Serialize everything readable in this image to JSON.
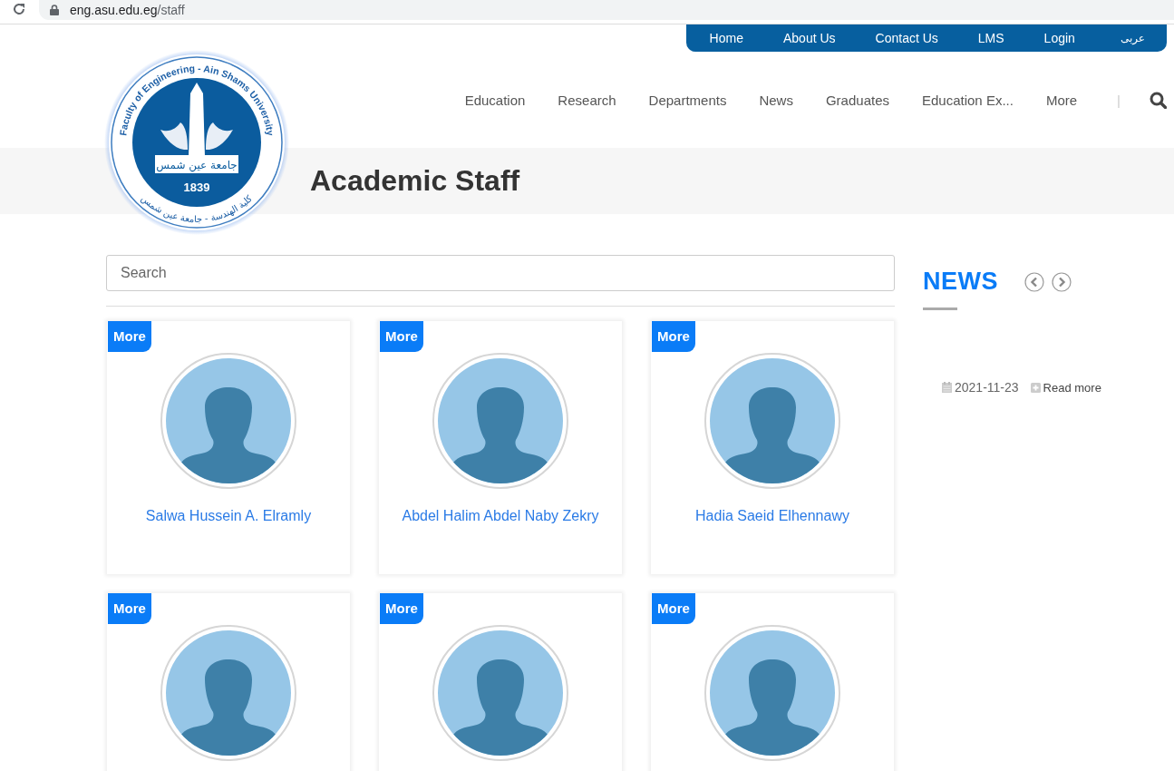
{
  "browser": {
    "url_host": "eng.asu.edu.eg",
    "url_path": "/staff"
  },
  "top_links": [
    "Home",
    "About Us",
    "Contact Us",
    "LMS",
    "Login",
    "عربى"
  ],
  "logo": {
    "ring_top": "Faculty of Engineering - Ain Shams University",
    "ring_bottom": "كلية الهندسة - جامعة عين شمس",
    "banner": "جامعة عين شمس",
    "year": "1839"
  },
  "nav": {
    "items": [
      "Education",
      "Research",
      "Departments",
      "News",
      "Graduates",
      "Education Ex...",
      "More"
    ],
    "separator": "|"
  },
  "page_title": "Academic Staff",
  "search": {
    "placeholder": "Search"
  },
  "staff": [
    {
      "tag": "More",
      "name": "Salwa Hussein A. Elramly"
    },
    {
      "tag": "More",
      "name": "Abdel Halim Abdel Naby Zekry"
    },
    {
      "tag": "More",
      "name": "Hadia Saeid Elhennawy"
    },
    {
      "tag": "More"
    },
    {
      "tag": "More"
    },
    {
      "tag": "More"
    }
  ],
  "news": {
    "title": "NEWS",
    "items": [
      {
        "date": "2021-11-23",
        "link": "Read more"
      }
    ]
  }
}
